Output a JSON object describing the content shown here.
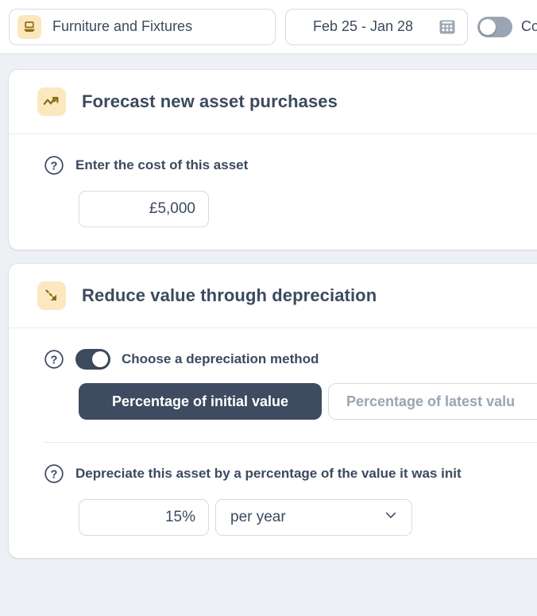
{
  "topbar": {
    "asset_selector": {
      "icon": "desk-icon",
      "label": "Furniture and Fixtures"
    },
    "date_range": {
      "label": "Feb 25 - Jan 28",
      "icon": "calendar-icon"
    },
    "compare_toggle": {
      "state": "off",
      "label": "Co"
    }
  },
  "cards": [
    {
      "icon": "trending-up-icon",
      "title": "Forecast new asset purchases",
      "question": {
        "icon": "help-circle-icon",
        "label": "Enter the cost of this asset"
      },
      "cost_input": {
        "value": "£5,000",
        "placeholder": "£0"
      }
    },
    {
      "icon": "arrow-down-right-icon",
      "title": "Reduce value through depreciation",
      "method_question": {
        "icon": "help-circle-icon",
        "label": "Choose a depreciation method",
        "toggle_state": "on"
      },
      "method_tabs": [
        {
          "label": "Percentage of initial value",
          "selected": true
        },
        {
          "label": "Percentage of latest valu",
          "selected": false
        }
      ],
      "rate_question": {
        "icon": "help-circle-icon",
        "label": "Depreciate this asset by a percentage of the value it was init"
      },
      "rate_input": {
        "value": "15%",
        "placeholder": "0%"
      },
      "period_select": {
        "value": "per year",
        "icon": "chevron-down-icon"
      }
    }
  ],
  "colors": {
    "page_background": "#edf0f4",
    "card_background": "#ffffff",
    "text_primary": "#3c4a5e",
    "text_muted": "#9aa5b4",
    "accent_icon_background": "#fce8c0",
    "accent_icon_foreground": "#8a6d15",
    "border": "#d5dbe2",
    "toggle_on": "#3c4a5e",
    "toggle_off": "#9aa5b4",
    "segment_active": "#3e4b60"
  }
}
